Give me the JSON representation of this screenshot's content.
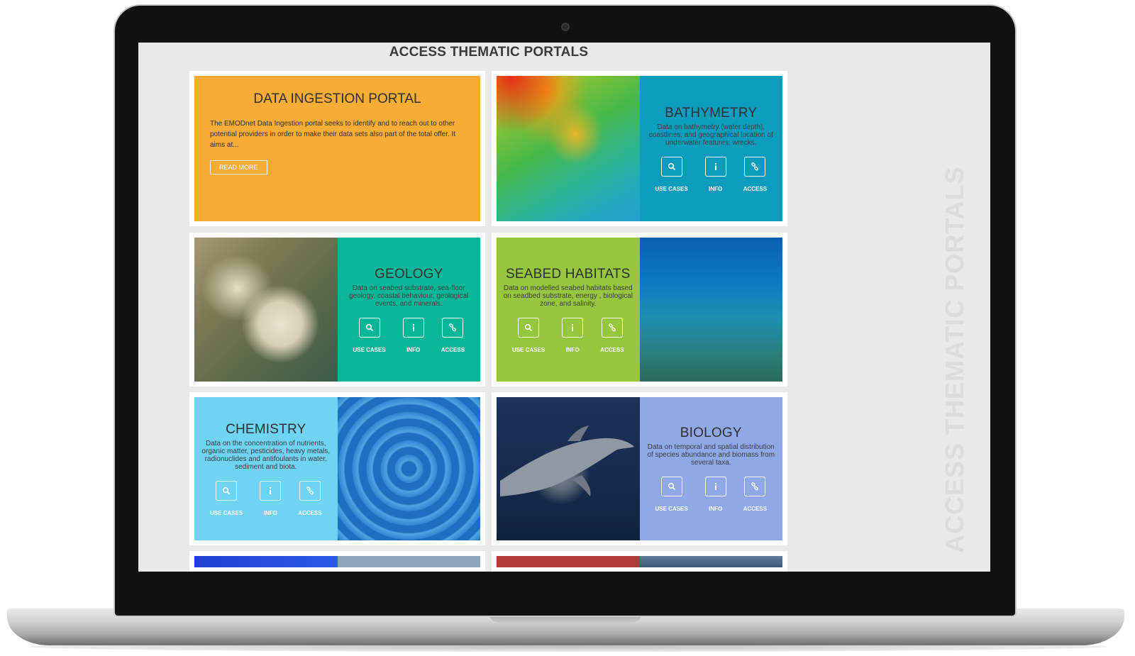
{
  "page_title": "ACCESS THEMATIC PORTALS",
  "vertical_title": "ACCESS THEMATIC PORTALS",
  "ingestion": {
    "title": "DATA INGESTION PORTAL",
    "text": "The EMODnet Data Ingestion portal seeks to identify and to reach out to other potential providers in order to make their data sets also part of the total offer. It aims at...",
    "button": "READ MORE"
  },
  "actions": {
    "use_cases": "USE CASES",
    "info": "INFO",
    "access": "ACCESS"
  },
  "portals": {
    "bathymetry": {
      "title": "BATHYMETRY",
      "desc": "Data on bathymetry (water depth), coastlines, and geographical location of underwater features: wrecks."
    },
    "geology": {
      "title": "GEOLOGY",
      "desc": "Data on seabed substrate, sea-floor geology, coastal behaviour, geological events, and minerals."
    },
    "seabed": {
      "title": "SEABED HABITATS",
      "desc": "Data on modelled seabed habitats based on seadbed substrate, energy , biological zone, and salinity."
    },
    "chemistry": {
      "title": "CHEMISTRY",
      "desc": "Data on the concentration of nutrients, organic matter, pesticides, heavy metals, radionuclides and antifoulants in water, sediment and biota."
    },
    "biology": {
      "title": "BIOLOGY",
      "desc": "Data on temporal and spatial distribution of species abundance and biomass from several taxa."
    }
  },
  "colors": {
    "ingestion": "#f6ac35",
    "bathymetry": "#0b9dbd",
    "geology": "#08b79a",
    "seabed": "#97c63f",
    "chemistry": "#6fd3f4",
    "biology": "#8fa9e8"
  }
}
